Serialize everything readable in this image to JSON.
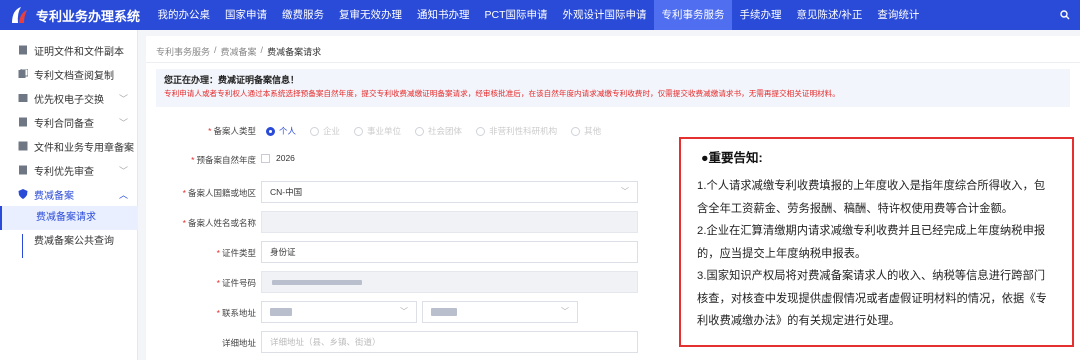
{
  "app": {
    "title": "专利业务办理系统"
  },
  "nav": {
    "items": [
      "我的办公桌",
      "国家申请",
      "缴费服务",
      "复审无效办理",
      "通知书办理",
      "PCT国际申请",
      "外观设计国际申请",
      "专利事务服务",
      "手续办理",
      "意见陈述/补正",
      "查询统计"
    ],
    "active_index": 7
  },
  "sidebar": {
    "items": [
      {
        "label": "证明文件和文件副本",
        "icon": "document-icon"
      },
      {
        "label": "专利文档查阅复制",
        "icon": "copy-icon"
      },
      {
        "label": "优先权电子交换",
        "icon": "exchange-icon"
      },
      {
        "label": "专利合同备查",
        "icon": "contract-icon"
      },
      {
        "label": "文件和业务专用章备案",
        "icon": "stamp-icon"
      },
      {
        "label": "专利优先审查",
        "icon": "priority-icon"
      },
      {
        "label": "费减备案",
        "icon": "shield-icon"
      }
    ],
    "sub_items": [
      "费减备案请求",
      "费减备案公共查询"
    ]
  },
  "breadcrumb": [
    "专利事务服务",
    "费减备案",
    "费减备案请求"
  ],
  "notice": {
    "title": "您正在办理：费减证明备案信息！",
    "text": "专利申请人或者专利权人通过本系统选择预备案自然年度，提交专利收费减缴证明备案请求，经审核批准后，在该自然年度内请求减缴专利收费时，仅需提交收费减缴请求书，无需再提交相关证明材料。"
  },
  "form": {
    "type_label": "备案人类型",
    "type_options": [
      "个人",
      "企业",
      "事业单位",
      "社会团体",
      "非营利性科研机构",
      "其他"
    ],
    "type_selected": "个人",
    "year_label": "预备案自然年度",
    "year_value": "2026",
    "nationality_label": "备案人国籍或地区",
    "nationality_value": "CN-中国",
    "name_label": "备案人姓名或名称",
    "id_type_label": "证件类型",
    "id_type_value": "身份证",
    "id_no_label": "证件号码",
    "address_label": "联系地址",
    "detail_label": "详细地址",
    "detail_placeholder": "详细地址（县、乡镇、街道）"
  },
  "important": {
    "title": "●重要告知:",
    "p1": "1.个人请求减缴专利收费填报的上年度收入是指年度综合所得收入，包含全年工资薪金、劳务报酬、稿酬、特许权使用费等合计金额。",
    "p2": "2.企业在汇算清缴期内请求减缴专利收费并且已经完成上年度纳税申报的，应当提交上年度纳税申报表。",
    "p3": "3.国家知识产权局将对费减备案请求人的收入、纳税等信息进行跨部门核查，对核查中发现提供虚假情况或者虚假证明材料的情况，依据《专利收费减缴办法》的有关规定进行处理。"
  },
  "colors": {
    "brand": "#2a4bd7",
    "warning": "#e52b2b"
  }
}
